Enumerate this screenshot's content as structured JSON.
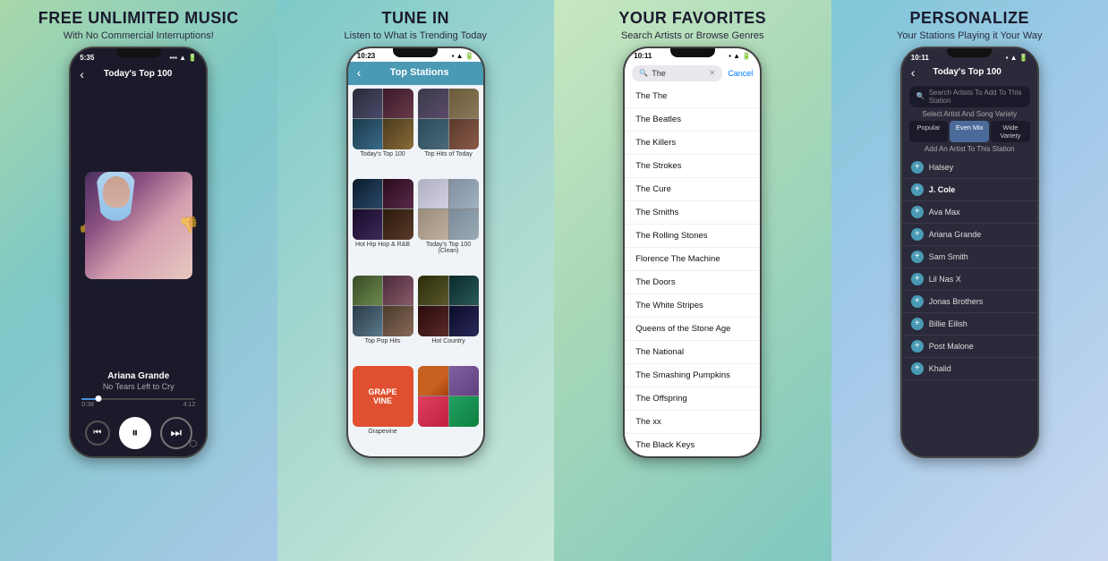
{
  "panels": [
    {
      "id": "panel-1",
      "title": "FREE UNLIMITED MUSIC",
      "subtitle": "With No Commercial Interruptions!",
      "phone": {
        "status_time": "5:35",
        "screen_title": "Today's Top 100",
        "artist": "Ariana Grande",
        "song": "No Tears Left to Cry",
        "time_current": "0:38",
        "time_total": "4:12",
        "progress_percent": 15
      }
    },
    {
      "id": "panel-2",
      "title": "TUNE IN",
      "subtitle": "Listen to What is Trending Today",
      "phone": {
        "status_time": "10:23",
        "screen_title": "Top Stations",
        "stations": [
          {
            "label": "Today's Top 100",
            "type": "quad"
          },
          {
            "label": "Top Hits of Today",
            "type": "quad"
          },
          {
            "label": "Hot Hip Hop & R&B",
            "type": "quad"
          },
          {
            "label": "Today's Top 100 (Clean)",
            "type": "quad"
          },
          {
            "label": "Top Pop Hits",
            "type": "quad"
          },
          {
            "label": "Hot Country",
            "type": "quad"
          },
          {
            "label": "Grapevine",
            "type": "special"
          },
          {
            "label": "",
            "type": "quad8"
          },
          {
            "label": "",
            "type": "quad9"
          }
        ]
      }
    },
    {
      "id": "panel-3",
      "title": "YOUR FAVORITES",
      "subtitle": "Search Artists or Browse Genres",
      "phone": {
        "status_time": "10:11",
        "search_placeholder": "The",
        "cancel_label": "Cancel",
        "results": [
          "The The",
          "The Beatles",
          "The Killers",
          "The Strokes",
          "The Cure",
          "The Smiths",
          "The Rolling Stones",
          "Florence   The Machine",
          "The Doors",
          "The White Stripes",
          "Queens of the Stone Age",
          "The National",
          "The Smashing Pumpkins",
          "The Offspring",
          "The xx",
          "The Black Keys"
        ]
      }
    },
    {
      "id": "panel-4",
      "title": "PERSONALIZE",
      "subtitle": "Your Stations Playing it Your Way",
      "phone": {
        "status_time": "10:11",
        "screen_title": "Today's Top 100",
        "search_placeholder": "Search Artists To Add To This Station",
        "variety_label": "Select Artist And Song Variety",
        "variety_options": [
          "Popular",
          "Even Mix",
          "Wide Variety"
        ],
        "active_variety": 1,
        "add_artist_label": "Add An Artist To This Station",
        "artists": [
          "Halsey",
          "J. Cole",
          "Ava Max",
          "Ariana Grande",
          "Sam Smith",
          "Lil Nas X",
          "Jonas Brothers",
          "Billie Eilish",
          "Post Malone",
          "Khalid"
        ]
      }
    }
  ]
}
